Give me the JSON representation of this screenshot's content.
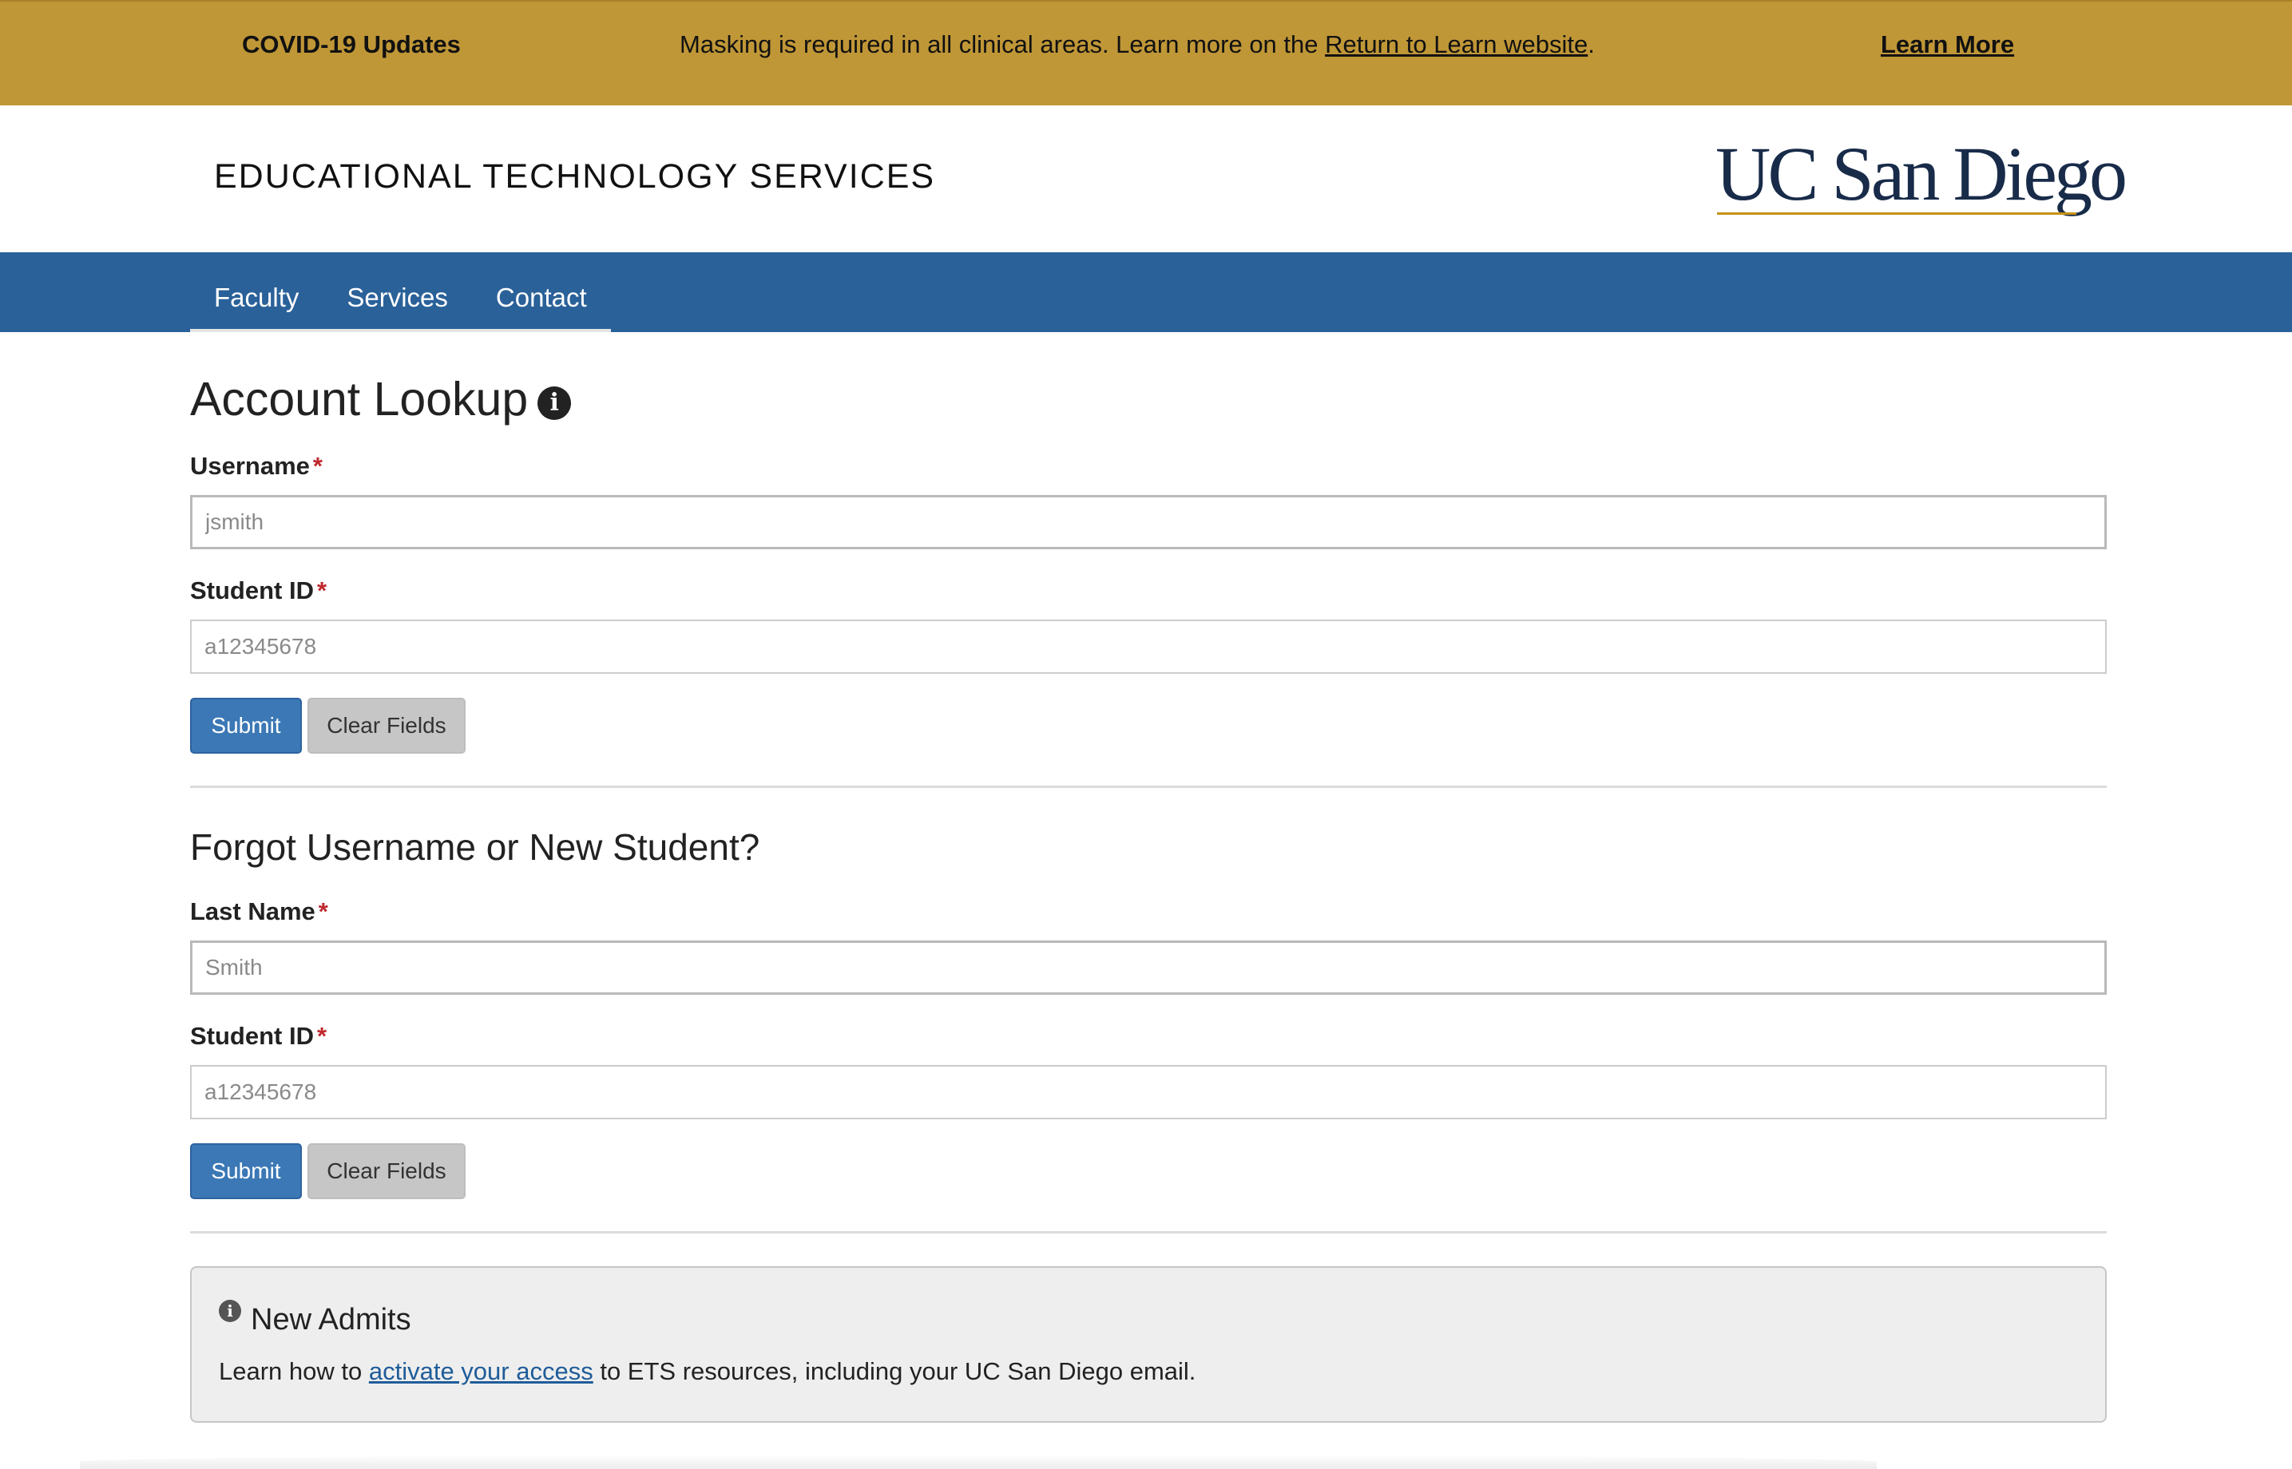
{
  "banner": {
    "title": "COVID-19 Updates",
    "message_prefix": "Masking is required in all clinical areas. Learn more on the ",
    "message_link": "Return to Learn website",
    "message_suffix": ".",
    "learn_more": "Learn More"
  },
  "header": {
    "site_title": "EDUCATIONAL TECHNOLOGY SERVICES",
    "logo_text": "UC San Diego"
  },
  "nav": {
    "items": [
      "Faculty",
      "Services",
      "Contact"
    ]
  },
  "lookup": {
    "title": "Account Lookup",
    "info_icon": "info-circle-icon",
    "username_label": "Username",
    "username_placeholder": "jsmith",
    "student_id_label": "Student ID",
    "student_id_placeholder": "a12345678",
    "submit": "Submit",
    "clear": "Clear Fields",
    "required_mark": "*"
  },
  "forgot": {
    "title": "Forgot Username or New Student?",
    "last_name_label": "Last Name",
    "last_name_placeholder": "Smith",
    "student_id_label": "Student ID",
    "student_id_placeholder": "a12345678",
    "submit": "Submit",
    "clear": "Clear Fields",
    "required_mark": "*"
  },
  "new_admits": {
    "title": "New Admits",
    "body_prefix": "Learn how to ",
    "body_link": "activate your access",
    "body_suffix": " to ETS resources, including your UC San Diego email."
  },
  "colors": {
    "banner_bg": "#c09737",
    "nav_bg": "#2a6199",
    "primary_button": "#3b78b5",
    "logo_navy": "#182b49",
    "logo_gold": "#c69214",
    "required": "#c0282d"
  }
}
